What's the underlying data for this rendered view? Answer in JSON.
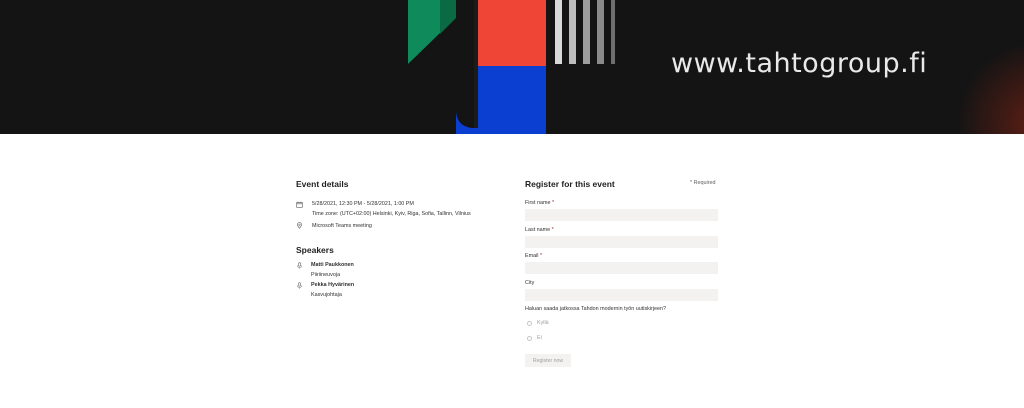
{
  "banner": {
    "url_text": "www.tahtogroup.fi"
  },
  "event_details": {
    "heading": "Event details",
    "date_range": "5/28/2021, 12:30 PM - 5/28/2021, 1:00 PM",
    "time_zone": "Time zone: (UTC+02:00) Helsinki, Kyiv, Riga, Sofia, Tallinn, Vilnius",
    "location": "Microsoft Teams meeting",
    "icons": {
      "date": "calendar-icon",
      "location": "location-pin-icon"
    }
  },
  "speakers": {
    "heading": "Speakers",
    "items": [
      {
        "name": "Matti Paukkonen",
        "role": "Piiriineuvoja",
        "icon": "microphone-icon"
      },
      {
        "name": "Pekka Hyvärinen",
        "role": "Kasvujohtaja",
        "icon": "microphone-icon"
      }
    ]
  },
  "registration": {
    "heading": "Register for this event",
    "required_note": "* Required",
    "fields": [
      {
        "label": "First name",
        "required_mark": "*",
        "value": ""
      },
      {
        "label": "Last name",
        "required_mark": "*",
        "value": ""
      },
      {
        "label": "Email",
        "required_mark": "*",
        "value": ""
      },
      {
        "label": "City",
        "required_mark": "",
        "value": ""
      }
    ],
    "question": "Haluan saada jatkossa Tahdon modernin työn uutiskirjeen?",
    "options": [
      "Kyllä",
      "Ei"
    ],
    "submit_label": "Register now"
  },
  "colors": {
    "banner_background": "#141414",
    "input_background": "#f3f2f1",
    "required_star": "#a4262c",
    "disabled_text": "#a19f9d"
  }
}
